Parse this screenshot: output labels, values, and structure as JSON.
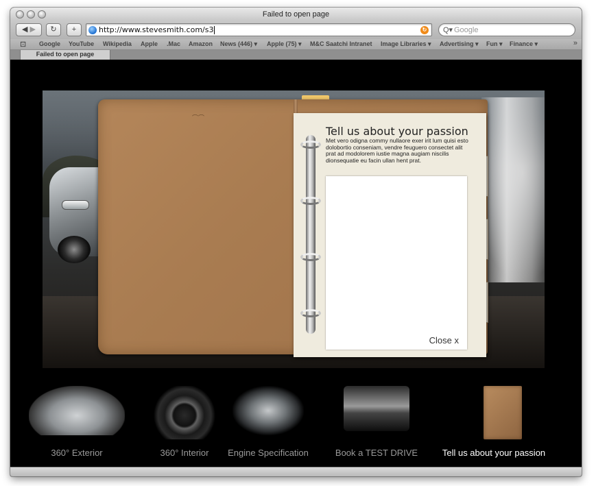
{
  "window": {
    "title": "Failed to open page"
  },
  "toolbar": {
    "url": "http://www.stevesmith.com/s3",
    "search_placeholder": "Google",
    "reload_icon": "reload-icon",
    "add_icon": "plus-icon"
  },
  "bookmarks": [
    "Google",
    "YouTube",
    "Wikipedia",
    "Apple",
    ".Mac",
    "Amazon",
    "News (446) ▾",
    "Apple (75) ▾",
    "M&C Saatchi Intranet",
    "Image Libraries ▾",
    "Advertising ▾",
    "Fun ▾",
    "Finance ▾"
  ],
  "tab": {
    "label": "Failed to open page"
  },
  "panel": {
    "title": "Tell us about your passion",
    "body": "Met vero odigna commy nullaore exer irit lum quisi esto dolobortio conseniam, vendre feuguero consectet alit prat ad modolorem iustie magna augiam niscilis dionsequatie eu facin ullan hent prat.",
    "close_label": "Close x"
  },
  "nav": {
    "items": [
      {
        "label": "360° Exterior",
        "active": false
      },
      {
        "label": "360° Interior",
        "active": false
      },
      {
        "label": "Engine Specification",
        "active": false
      },
      {
        "label": "Book a TEST DRIVE",
        "active": false
      },
      {
        "label": "Tell us about your passion",
        "active": true
      }
    ]
  },
  "colors": {
    "page_bg": "#000000",
    "folder": "#a97c51",
    "paper": "#efebde",
    "nav_active": "#ffffff",
    "nav_inactive": "#9a9a9a"
  }
}
